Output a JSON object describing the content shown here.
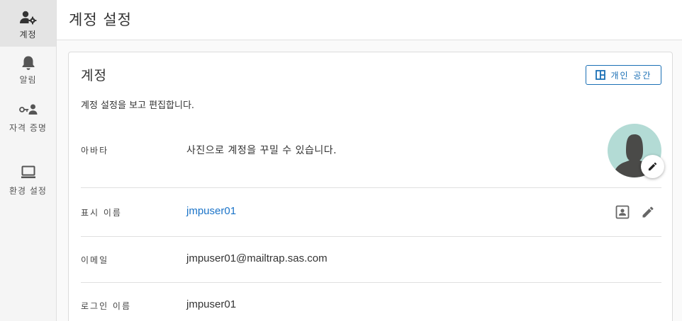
{
  "sidebar": {
    "items": [
      {
        "label": "계정",
        "icon": "account-settings-icon",
        "active": true
      },
      {
        "label": "알림",
        "icon": "bell-icon",
        "active": false
      },
      {
        "label": "자격 증명",
        "icon": "key-person-icon",
        "active": false
      },
      {
        "label": "환경 설정",
        "icon": "monitor-icon",
        "active": false
      }
    ]
  },
  "header": {
    "title": "계정 설정"
  },
  "card": {
    "title": "계정",
    "personal_space_label": "개인 공간",
    "description": "계정 설정을 보고 편집합니다.",
    "rows": {
      "avatar": {
        "label": "아바타",
        "value": "사진으로 계정을 꾸밀 수 있습니다."
      },
      "display_name": {
        "label": "표시 이름",
        "value": "jmpuser01"
      },
      "email": {
        "label": "이메일",
        "value": "jmpuser01@mailtrap.sas.com"
      },
      "login_name": {
        "label": "로그인 이름",
        "value": "jmpuser01"
      }
    }
  },
  "colors": {
    "accent": "#1a6fb5",
    "link": "#1a73c8",
    "avatar_bg": "#b3dbd5",
    "sidebar_bg": "#f5f5f5",
    "sidebar_active_bg": "#e4e4e4"
  }
}
